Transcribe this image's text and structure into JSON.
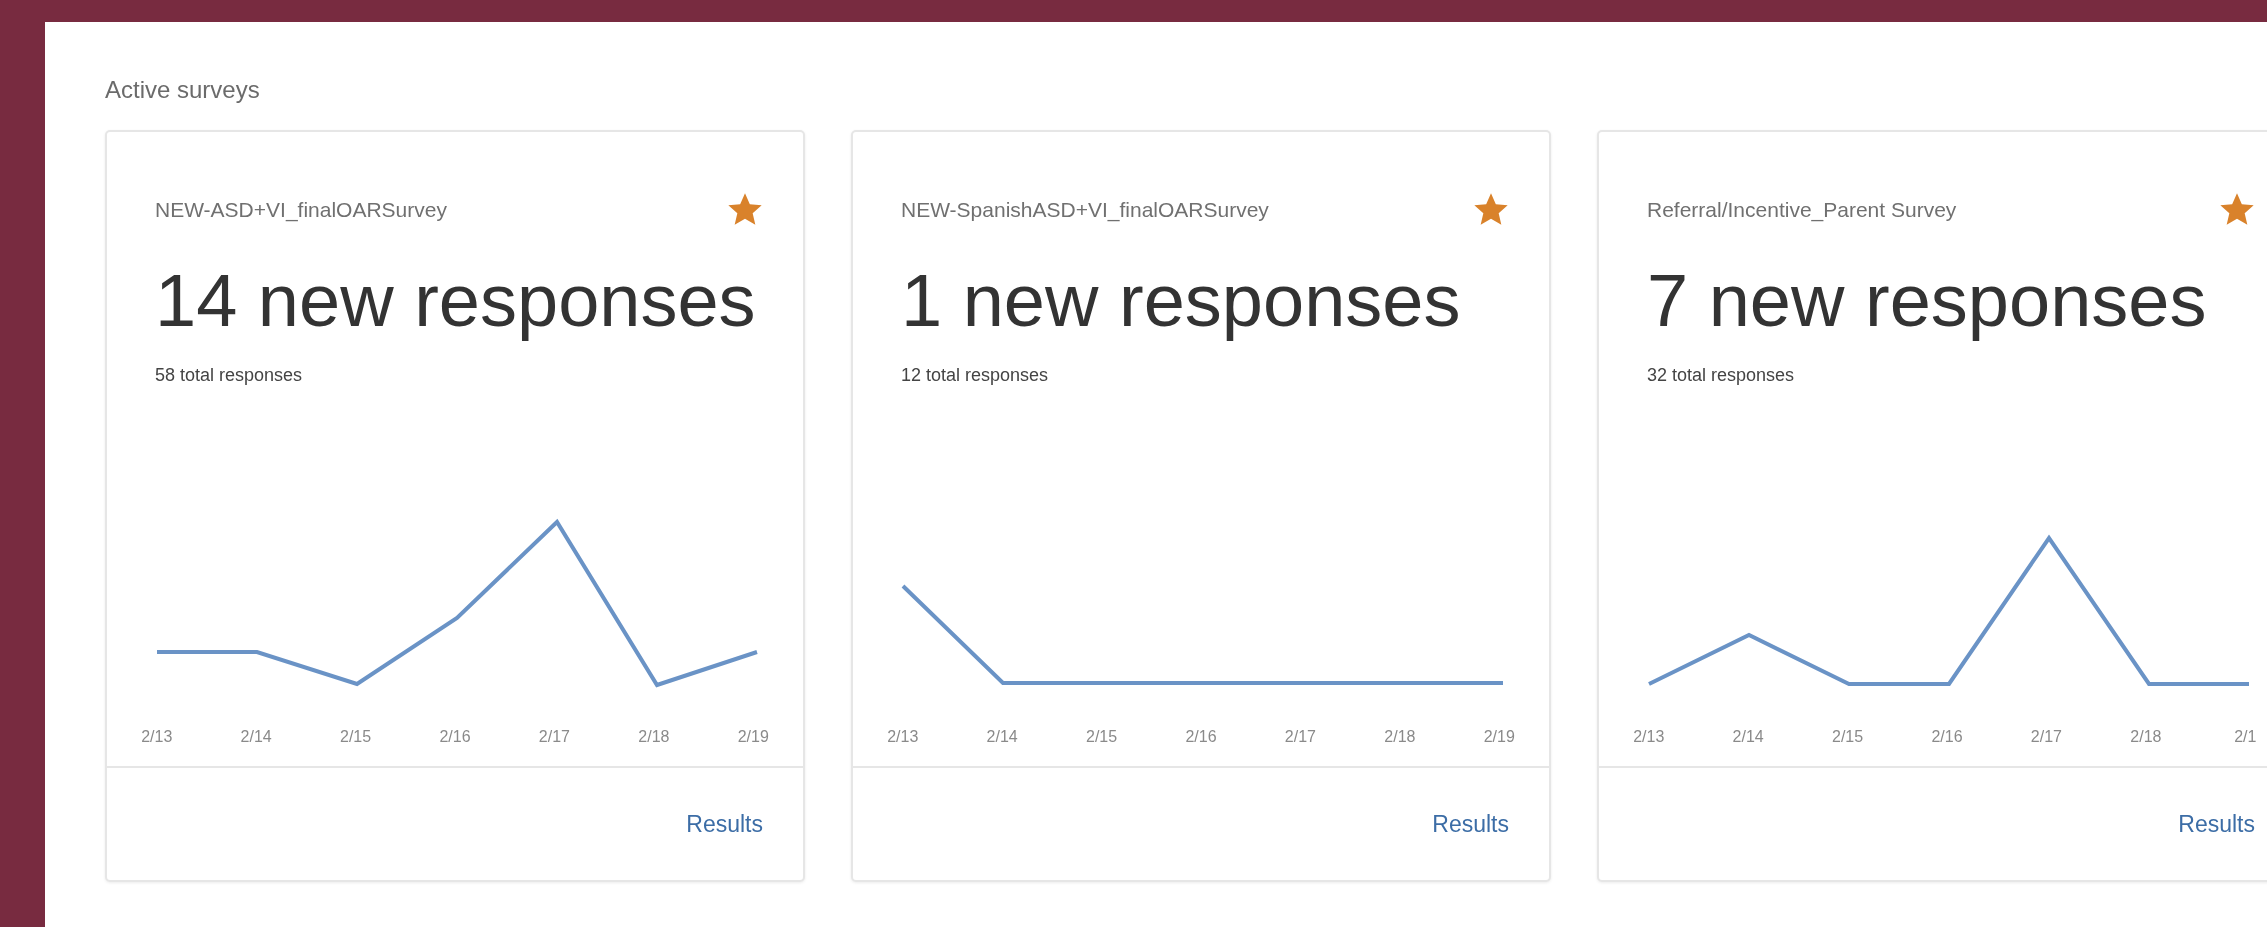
{
  "section_title": "Active surveys",
  "surveys": [
    {
      "name": "NEW-ASD+VI_finalOARSurvey",
      "starred": true,
      "new_responses": "14 new responses",
      "total_responses": "58 total responses",
      "x_labels": [
        "2/13",
        "2/14",
        "2/15",
        "2/16",
        "2/17",
        "2/18",
        "2/19"
      ],
      "link": "Results"
    },
    {
      "name": "NEW-SpanishASD+VI_finalOARSurvey",
      "starred": true,
      "new_responses": "1 new responses",
      "total_responses": "12 total responses",
      "x_labels": [
        "2/13",
        "2/14",
        "2/15",
        "2/16",
        "2/17",
        "2/18",
        "2/19"
      ],
      "link": "Results"
    },
    {
      "name": "Referral/Incentive_Parent Survey",
      "starred": true,
      "new_responses": "7 new responses",
      "total_responses": "32 total responses",
      "x_labels": [
        "2/13",
        "2/14",
        "2/15",
        "2/16",
        "2/17",
        "2/18",
        "2/1"
      ],
      "link": "Results"
    }
  ]
}
